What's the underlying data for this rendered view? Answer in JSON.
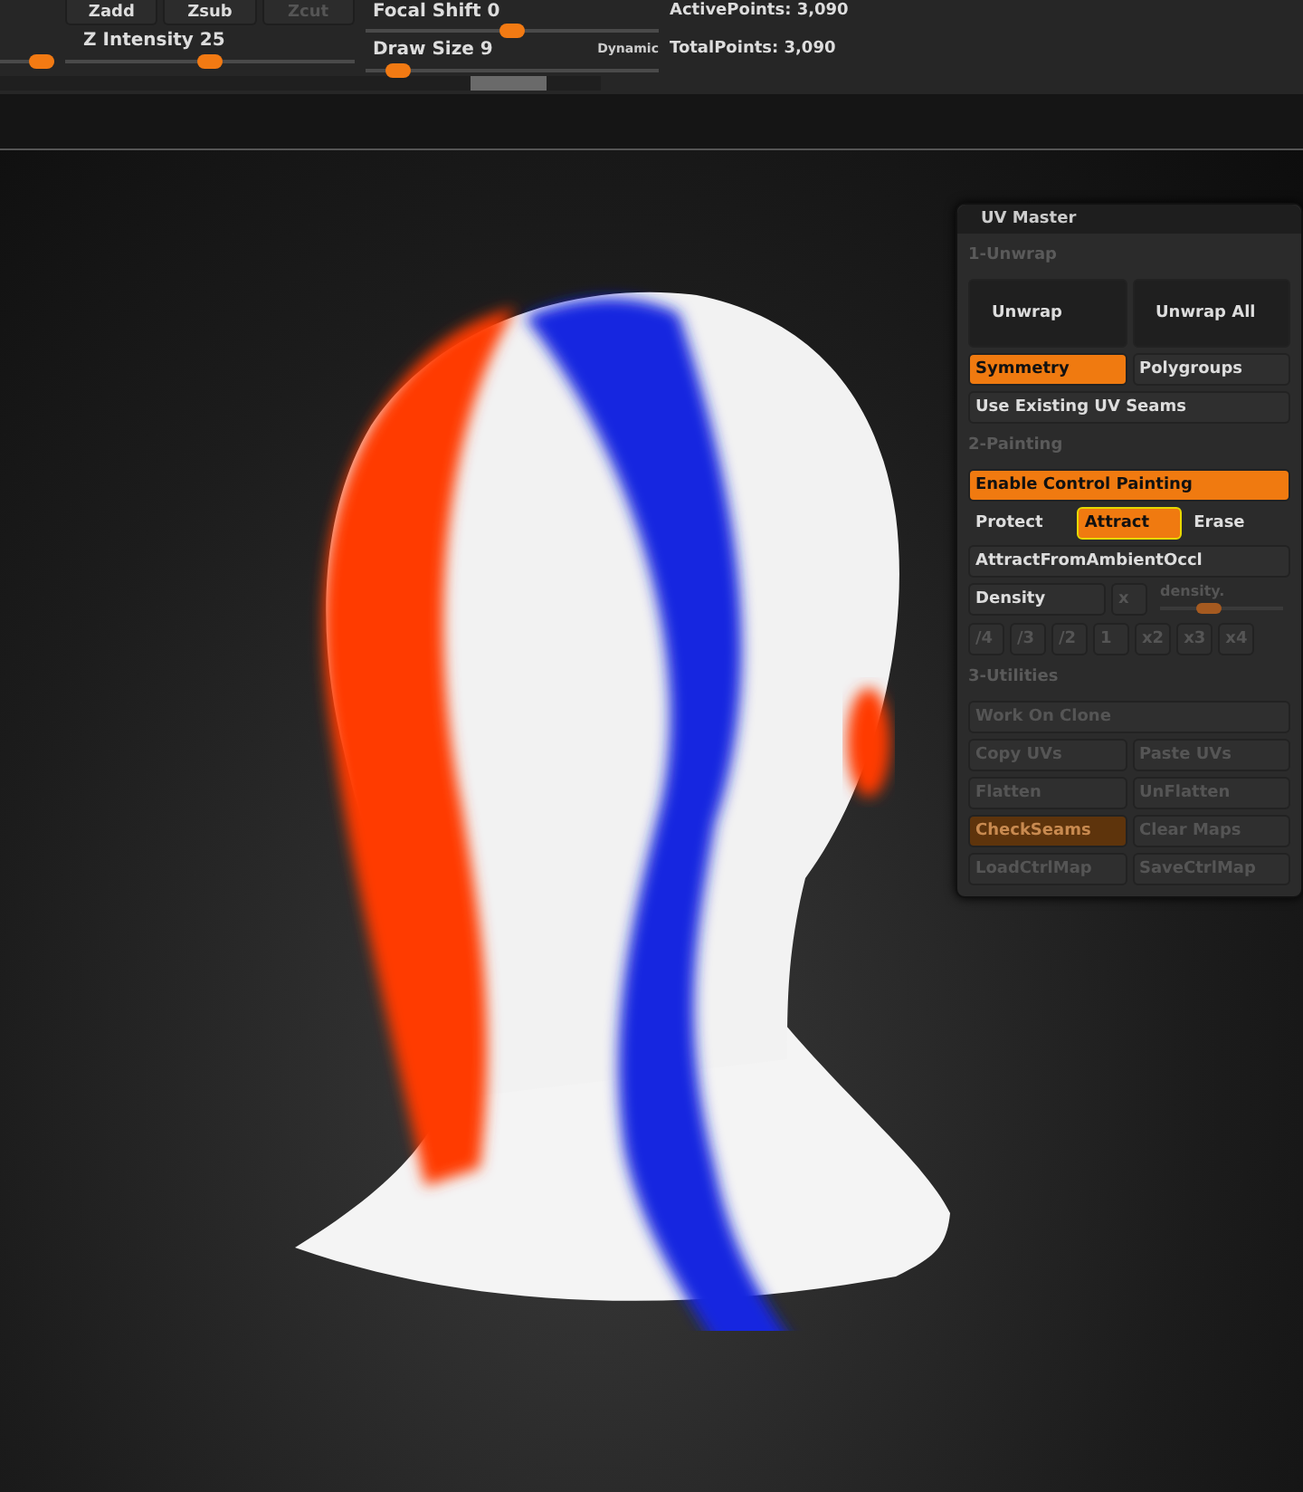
{
  "toolbar": {
    "edge_slider": {
      "level": 0.75
    },
    "buttons": [
      {
        "label": "Zadd",
        "disabled": false
      },
      {
        "label": "Zsub",
        "disabled": false
      },
      {
        "label": "Zcut",
        "disabled": true
      }
    ],
    "z_intensity": {
      "label": "Z Intensity 25",
      "level": 0.5
    },
    "focal_shift": {
      "label": "Focal Shift 0",
      "level": 0.5
    },
    "draw_size": {
      "label": "Draw Size 9",
      "level": 0.11
    },
    "dynamic": {
      "label": "Dynamic"
    },
    "stats": [
      "ActivePoints: 3,090",
      "TotalPoints: 3,090"
    ]
  },
  "panel": {
    "title": "UV Master",
    "sections": [
      {
        "title": "1-Unwrap",
        "rows": [
          {
            "items": [
              {
                "kind": "large",
                "label": "Unwrap",
                "selected": false,
                "disabled": false
              },
              {
                "kind": "large",
                "label": "Unwrap All",
                "selected": false,
                "disabled": false
              }
            ]
          },
          {
            "items": [
              {
                "kind": "button",
                "label": "Symmetry",
                "selected": true,
                "disabled": false
              },
              {
                "kind": "button",
                "label": "Polygroups",
                "selected": false,
                "disabled": false
              }
            ]
          },
          {
            "items": [
              {
                "kind": "button",
                "label": "Use Existing UV Seams",
                "selected": false,
                "disabled": false
              }
            ]
          }
        ]
      },
      {
        "title": "2-Painting",
        "rows": [
          {
            "items": [
              {
                "kind": "button",
                "label": "Enable Control Painting",
                "selected": true,
                "disabled": false
              }
            ]
          },
          {
            "items": [
              {
                "kind": "plain",
                "label": "Protect",
                "selected": false,
                "disabled": false
              },
              {
                "kind": "button",
                "label": "Attract",
                "selected": true,
                "focused": true,
                "disabled": false
              },
              {
                "kind": "plain",
                "label": "Erase",
                "selected": false,
                "disabled": false
              }
            ]
          },
          {
            "items": [
              {
                "kind": "button",
                "label": "AttractFromAmbientOccl",
                "selected": false,
                "disabled": false
              }
            ]
          },
          {
            "items": [
              {
                "kind": "button",
                "label": "Density",
                "selected": false,
                "disabled": false
              },
              {
                "kind": "small",
                "label": "x",
                "selected": false,
                "disabled": true
              },
              {
                "kind": "slider",
                "label": "density.",
                "level": 0.4,
                "disabled": true
              }
            ]
          },
          {
            "items": [
              {
                "kind": "small",
                "label": "/4",
                "selected": false,
                "disabled": true
              },
              {
                "kind": "small",
                "label": "/3",
                "selected": false,
                "disabled": true
              },
              {
                "kind": "small",
                "label": "/2",
                "selected": false,
                "disabled": true
              },
              {
                "kind": "small",
                "label": "1",
                "selected": false,
                "disabled": true
              },
              {
                "kind": "small",
                "label": "x2",
                "selected": false,
                "disabled": true
              },
              {
                "kind": "small",
                "label": "x3",
                "selected": false,
                "disabled": true
              },
              {
                "kind": "small",
                "label": "x4",
                "selected": false,
                "disabled": true
              }
            ]
          }
        ]
      },
      {
        "title": "3-Utilities",
        "rows": [
          {
            "items": [
              {
                "kind": "button",
                "label": "Work On Clone",
                "selected": false,
                "disabled": true
              }
            ]
          },
          {
            "items": [
              {
                "kind": "button",
                "label": "Copy UVs",
                "selected": false,
                "disabled": true
              },
              {
                "kind": "button",
                "label": "Paste UVs",
                "selected": false,
                "disabled": true
              }
            ]
          },
          {
            "items": [
              {
                "kind": "button",
                "label": "Flatten",
                "selected": false,
                "disabled": true
              },
              {
                "kind": "button",
                "label": "UnFlatten",
                "selected": false,
                "disabled": true
              }
            ]
          },
          {
            "items": [
              {
                "kind": "button",
                "label": "CheckSeams",
                "selected": true,
                "disabled": true
              },
              {
                "kind": "button",
                "label": "Clear Maps",
                "selected": false,
                "disabled": true
              }
            ]
          },
          {
            "items": [
              {
                "kind": "button",
                "label": "LoadCtrlMap",
                "selected": false,
                "disabled": true
              },
              {
                "kind": "button",
                "label": "SaveCtrlMap",
                "selected": false,
                "disabled": true
              }
            ]
          }
        ]
      }
    ]
  }
}
